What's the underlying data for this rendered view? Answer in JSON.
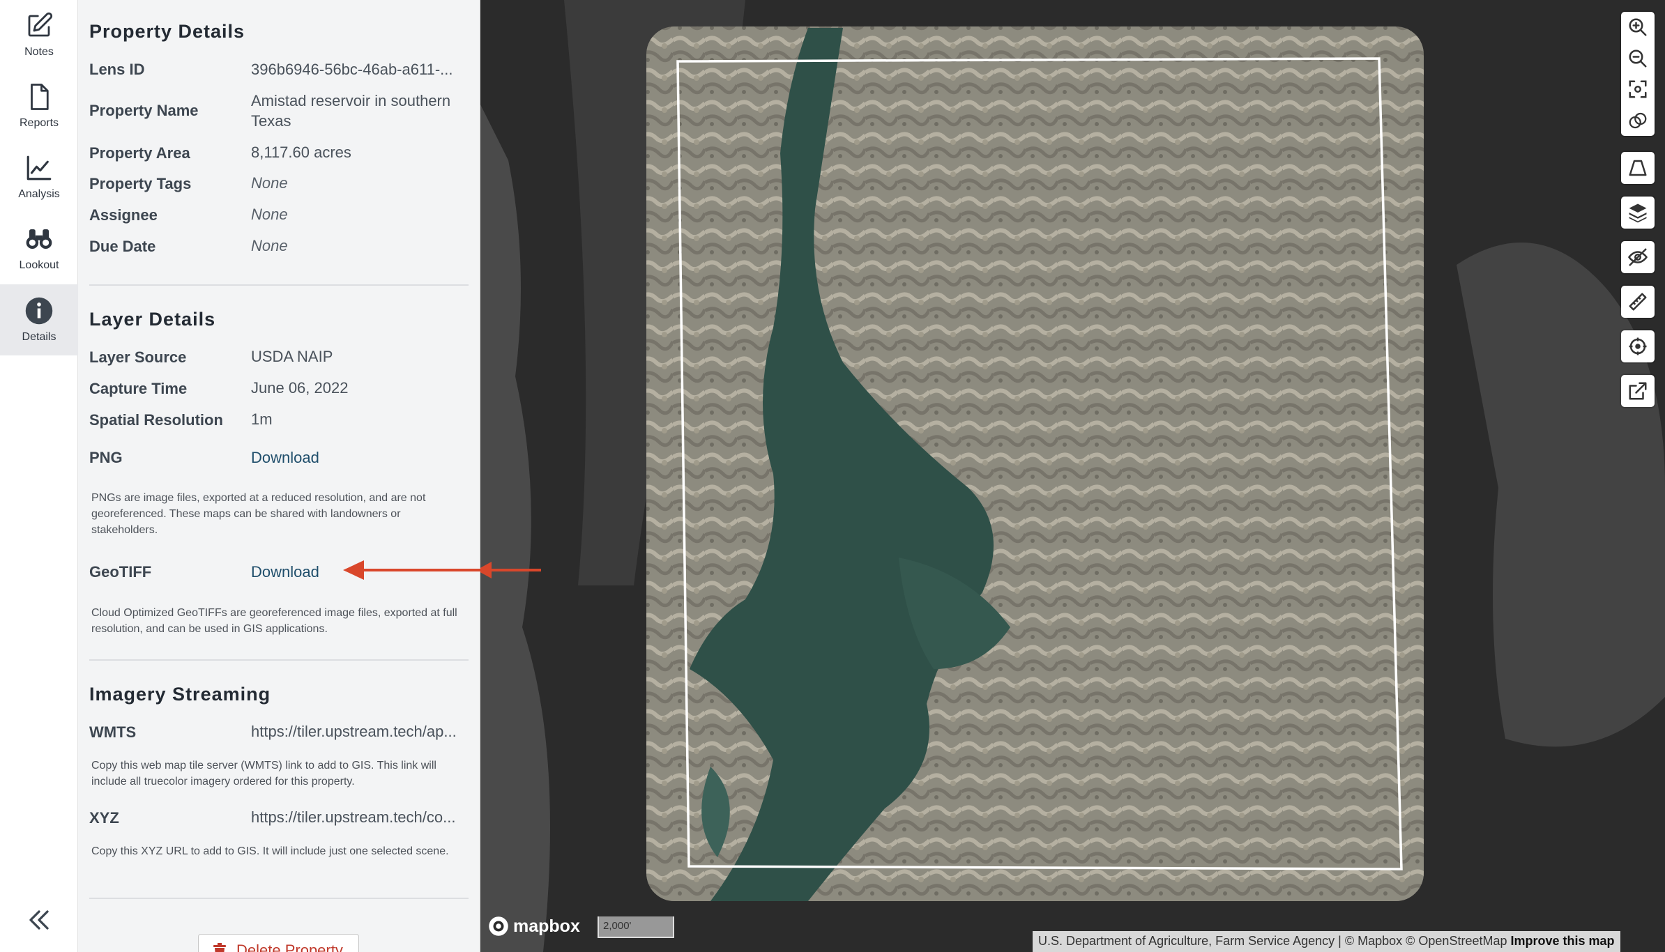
{
  "rail": {
    "items": [
      {
        "label": "Notes",
        "icon": "pencil-square-icon"
      },
      {
        "label": "Reports",
        "icon": "document-icon"
      },
      {
        "label": "Analysis",
        "icon": "line-chart-icon"
      },
      {
        "label": "Lookout",
        "icon": "binoculars-icon"
      },
      {
        "label": "Details",
        "icon": "info-circle-icon",
        "active": true
      }
    ],
    "collapse_icon": "double-chevron-left-icon"
  },
  "property_details": {
    "title": "Property Details",
    "rows": [
      {
        "label": "Lens ID",
        "value": "396b6946-56bc-46ab-a611-..."
      },
      {
        "label": "Property Name",
        "value": "Amistad reservoir in southern Texas"
      },
      {
        "label": "Property Area",
        "value": "8,117.60 acres"
      },
      {
        "label": "Property Tags",
        "value": "None"
      },
      {
        "label": "Assignee",
        "value": "None"
      },
      {
        "label": "Due Date",
        "value": "None"
      }
    ]
  },
  "layer_details": {
    "title": "Layer Details",
    "rows": [
      {
        "label": "Layer Source",
        "value": "USDA NAIP"
      },
      {
        "label": "Capture Time",
        "value": "June 06, 2022"
      },
      {
        "label": "Spatial Resolution",
        "value": "1m"
      }
    ],
    "png": {
      "label": "PNG",
      "link": "Download",
      "note": "PNGs are image files, exported at a reduced resolution, and are not georeferenced. These maps can be shared with landowners or stakeholders."
    },
    "geotiff": {
      "label": "GeoTIFF",
      "link": "Download",
      "note": "Cloud Optimized GeoTIFFs are georeferenced image files, exported at full resolution, and can be used in GIS applications."
    }
  },
  "imagery_streaming": {
    "title": "Imagery Streaming",
    "wmts": {
      "label": "WMTS",
      "value": "https://tiler.upstream.tech/ap...",
      "note": "Copy this web map tile server (WMTS) link to add to GIS. This link will include all truecolor imagery ordered for this property."
    },
    "xyz": {
      "label": "XYZ",
      "value": "https://tiler.upstream.tech/co...",
      "note": "Copy this XYZ URL to add to GIS. It will include just one selected scene."
    }
  },
  "delete_button": {
    "label": "Delete Property",
    "icon": "trash-icon"
  },
  "map": {
    "scale": "2,000'",
    "logo": "mapbox",
    "attribution": "U.S. Department of Agriculture, Farm Service Agency | © Mapbox © OpenStreetMap",
    "attribution_link": "Improve this map",
    "annotation_color": "#d9472b",
    "controls": [
      "zoom-in-icon",
      "zoom-out-icon",
      "fit-bounds-icon",
      "compare-icon",
      "draw-polygon-icon",
      "layers-icon",
      "hide-overlay-icon",
      "measure-ruler-icon",
      "locate-icon",
      "share-external-icon"
    ]
  }
}
